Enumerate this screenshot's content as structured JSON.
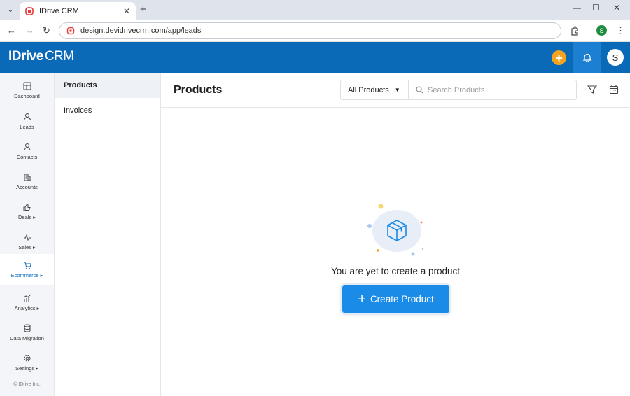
{
  "browser": {
    "tab_title": "IDrive CRM",
    "tab_close": "✕",
    "new_tab": "+",
    "url": "design.devidrivecrm.com/app/leads",
    "profile_initial": "S",
    "window": {
      "minimize": "—",
      "maximize": "☐",
      "close": "✕"
    }
  },
  "header": {
    "logo_main": "IDrive",
    "logo_suffix": "CRM",
    "quick_add": "+",
    "avatar_initial": "S"
  },
  "sidebar": {
    "items": [
      {
        "label": "Dashboard",
        "icon": "dashboard-icon"
      },
      {
        "label": "Leads",
        "icon": "leads-icon"
      },
      {
        "label": "Contacts",
        "icon": "contacts-icon"
      },
      {
        "label": "Accounts",
        "icon": "accounts-icon"
      },
      {
        "label": "Deals ▸",
        "icon": "deals-icon"
      },
      {
        "label": "Sales ▸",
        "icon": "sales-icon"
      },
      {
        "label": "Ecommerce ▸",
        "icon": "ecommerce-icon"
      },
      {
        "label": "Analytics ▸",
        "icon": "analytics-icon"
      },
      {
        "label": "Data Migration",
        "icon": "data-migration-icon"
      },
      {
        "label": "Settings ▸",
        "icon": "settings-icon"
      }
    ],
    "copyright": "© IDrive Inc."
  },
  "subnav": {
    "items": [
      {
        "label": "Products"
      },
      {
        "label": "Invoices"
      }
    ]
  },
  "main": {
    "title": "Products",
    "filter_dropdown": "All Products",
    "search_placeholder": "Search Products",
    "empty_message": "You are yet to create a product",
    "create_button": "Create Product"
  },
  "colors": {
    "brand": "#0a6ab8",
    "accent": "#f5a321",
    "primary_button": "#1a8be6"
  }
}
